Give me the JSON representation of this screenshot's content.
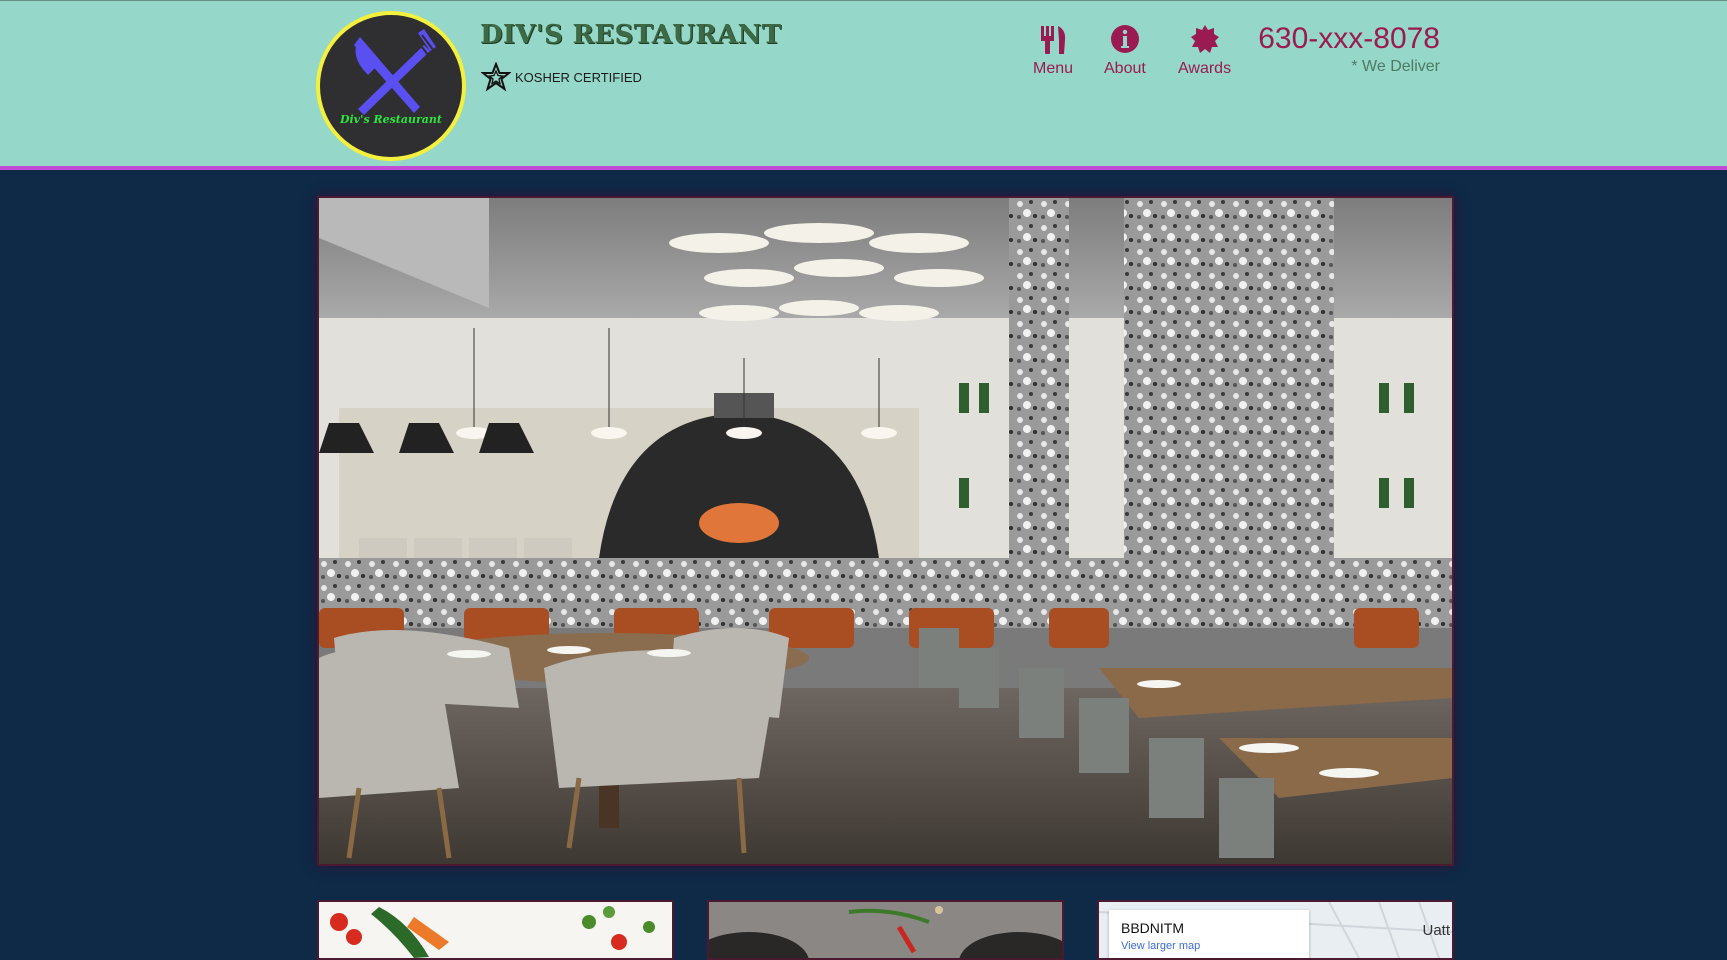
{
  "brand": {
    "title": "DIV'S RESTAURANT",
    "logo_text": "Div's Restaurant",
    "kosher_label": "KOSHER CERTIFIED",
    "kosher_icon": "star-icon",
    "logo_icon": "fork-knife-icon"
  },
  "nav": [
    {
      "label": "Menu",
      "icon": "utensils-icon"
    },
    {
      "label": "About",
      "icon": "info-icon"
    },
    {
      "label": "Awards",
      "icon": "badge-icon"
    }
  ],
  "contact": {
    "phone": "630-xxx-8078",
    "delivery_note": "* We Deliver"
  },
  "hero": {
    "subject": "restaurant dining room interior"
  },
  "cards": [
    {
      "subject": "fresh vegetables"
    },
    {
      "subject": "plated dishes with herbs"
    },
    {
      "subject": "map",
      "place_name": "BBDNITM",
      "link_text": "View larger map",
      "city_text": "Uatt"
    }
  ],
  "colors": {
    "header_bg": "#95d7c8",
    "page_bg": "#0e2a47",
    "accent": "#9a1b52",
    "logo_ring": "#f3f13e",
    "header_border": "#c44bd6"
  }
}
